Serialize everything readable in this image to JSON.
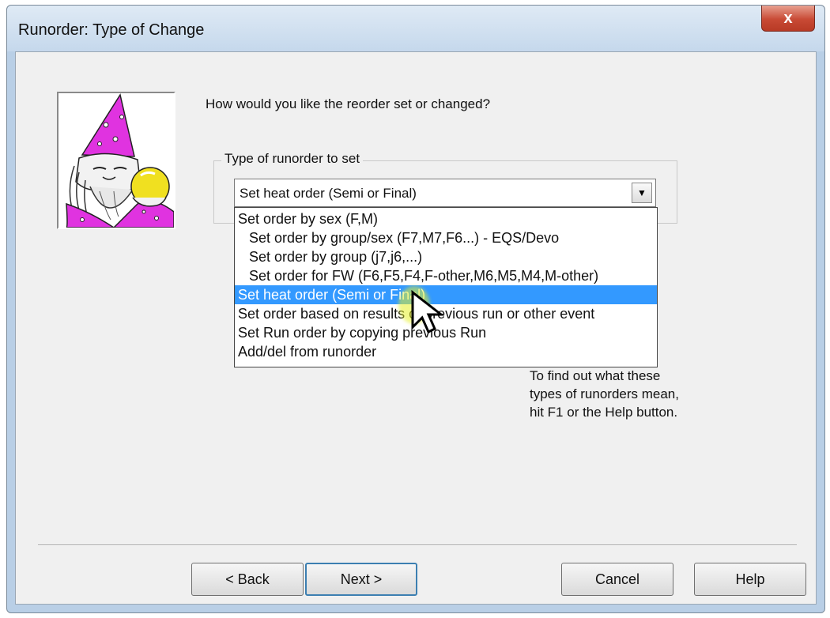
{
  "window": {
    "title": "Runorder: Type of Change",
    "close_label": "x"
  },
  "main": {
    "question": "How would you like the reorder set or changed?",
    "group_label": "Type of runorder to set",
    "combo_value": "Set heat order (Semi or Final)",
    "dropdown_items": [
      "Set order by sex (F,M)",
      "Set order by group/sex (F7,M7,F6...) - EQS/Devo",
      "Set order by group (j7,j6,...)",
      "Set order for FW (F6,F5,F4,F-other,M6,M5,M4,M-other)",
      "Set heat order (Semi or Final)",
      "Set order based on results of previous run or other event",
      "Set Run order by copying previous Run",
      "Add/del from runorder"
    ],
    "selected_index": 4,
    "help_lines": [
      "To find out what these",
      "types of runorders mean,",
      "hit F1 or the Help button."
    ]
  },
  "buttons": {
    "back": "< Back",
    "next": "Next >",
    "cancel": "Cancel",
    "help": "Help"
  },
  "colors": {
    "selection": "#3399ff",
    "wizard_hat": "#e033e0",
    "crystal_ball": "#f0e020"
  }
}
